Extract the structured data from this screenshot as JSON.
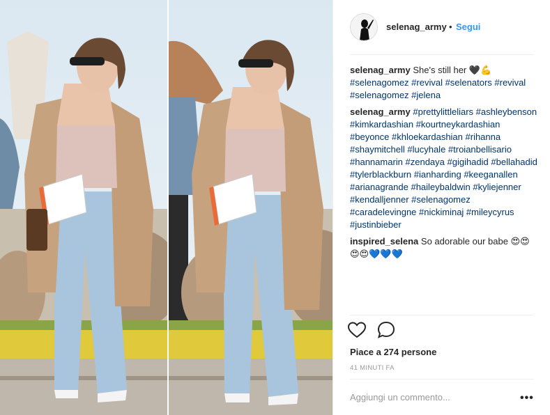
{
  "post": {
    "username": "selenag_army",
    "dot": "•",
    "follow_label": "Segui"
  },
  "comments": [
    {
      "user": "selenag_army",
      "text": "She's still her 🖤💪",
      "tags": "#selenagomez #revival #selenators #revival #selenagomez #jelena"
    },
    {
      "user": "selenag_army",
      "text": "",
      "tags": "#prettylittleliars #ashleybenson #kimkardashian #kourtneykardashian #beyonce #khloekardashian #rihanna #shaymitchell #lucyhale #troianbellisario #hannamarin #zendaya #gigihadid #bellahadid #tylerblackburn #ianharding #keeganallen #arianagrande #haileybaldwin #kyliejenner #kendalljenner #selenagomez #caradelevingne #nickiminaj #mileycyrus #justinbieber"
    },
    {
      "user": "inspired_selena",
      "text": "So adorable our babe 😍😍 😍😍💙💙💙",
      "tags": ""
    }
  ],
  "likes": {
    "prefix": "Piace a ",
    "count": "274",
    "suffix": " persone"
  },
  "time": "41 MINUTI FA",
  "add_comment_placeholder": "Aggiungi un commento...",
  "more_label": "•••",
  "icons": {
    "like": "heart-outline-icon",
    "comment": "speech-bubble-icon",
    "more": "ellipsis-icon"
  },
  "colors": {
    "follow": "#3897f0",
    "hashtag": "#003569",
    "muted": "#999999"
  }
}
